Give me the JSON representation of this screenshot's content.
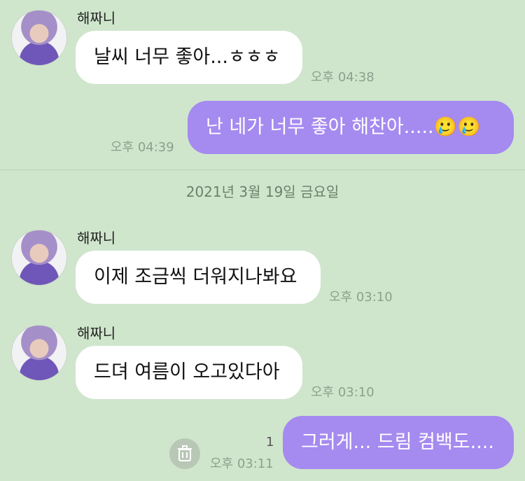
{
  "messages": [
    {
      "sender": "해짜니",
      "text": "날씨 너무 좋아...ㅎㅎㅎ",
      "time": "오후 04:38"
    },
    {
      "text": "난 네가 너무 좋아 해찬아.....🥲🥲",
      "time": "오후 04:39"
    },
    {
      "date": "2021년 3월 19일 금요일"
    },
    {
      "sender": "해짜니",
      "text": "이제 조금씩 더워지나봐요",
      "time": "오후 03:10"
    },
    {
      "sender": "해짜니",
      "text": "드뎌 여름이 오고있다아",
      "time": "오후 03:10"
    },
    {
      "text": "그러게... 드림 컴백도....",
      "time": "오후 03:11",
      "unread": "1"
    }
  ],
  "icons": {
    "avatar": "avatar-photo",
    "trash": "trash-icon"
  },
  "colors": {
    "background": "#cfe6cc",
    "incoming_bubble": "#ffffff",
    "outgoing_bubble": "#a58af0",
    "timestamp": "#8f9f8e"
  }
}
